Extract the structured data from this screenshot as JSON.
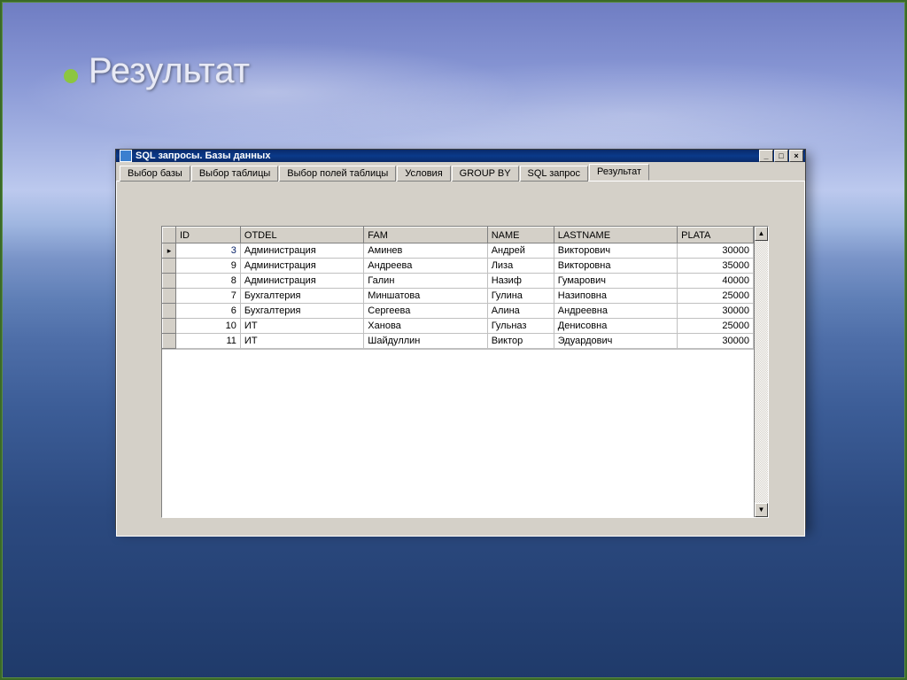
{
  "slide": {
    "title": "Результат"
  },
  "window": {
    "title": "SQL запросы. Базы данных"
  },
  "tabs": [
    {
      "label": "Выбор базы"
    },
    {
      "label": "Выбор таблицы"
    },
    {
      "label": "Выбор полей таблицы"
    },
    {
      "label": "Условия"
    },
    {
      "label": "GROUP BY"
    },
    {
      "label": "SQL запрос"
    },
    {
      "label": "Результат",
      "active": true
    }
  ],
  "grid": {
    "columns": [
      "ID",
      "OTDEL",
      "FAM",
      "NAME",
      "LASTNAME",
      "PLATA"
    ],
    "rows": [
      {
        "id": 3,
        "otdel": "Администрация",
        "fam": "Аминев",
        "name": "Андрей",
        "lastname": "Викторович",
        "plata": 30000,
        "current": true
      },
      {
        "id": 9,
        "otdel": "Администрация",
        "fam": "Андреева",
        "name": "Лиза",
        "lastname": "Викторовна",
        "plata": 35000
      },
      {
        "id": 8,
        "otdel": "Администрация",
        "fam": "Галин",
        "name": "Назиф",
        "lastname": "Гумарович",
        "plata": 40000
      },
      {
        "id": 7,
        "otdel": "Бухгалтерия",
        "fam": "Миншатова",
        "name": "Гулина",
        "lastname": "Назиповна",
        "plata": 25000
      },
      {
        "id": 6,
        "otdel": "Бухгалтерия",
        "fam": "Сергеева",
        "name": "Алина",
        "lastname": "Андреевна",
        "plata": 30000
      },
      {
        "id": 10,
        "otdel": "ИТ",
        "fam": "Ханова",
        "name": "Гульназ",
        "lastname": "Денисовна",
        "plata": 25000
      },
      {
        "id": 11,
        "otdel": "ИТ",
        "fam": "Шайдуллин",
        "name": "Виктор",
        "lastname": "Эдуардович",
        "plata": 30000
      }
    ]
  },
  "win_controls": {
    "min": "_",
    "max": "□",
    "close": "×"
  },
  "scroll": {
    "up": "▲",
    "down": "▼"
  }
}
